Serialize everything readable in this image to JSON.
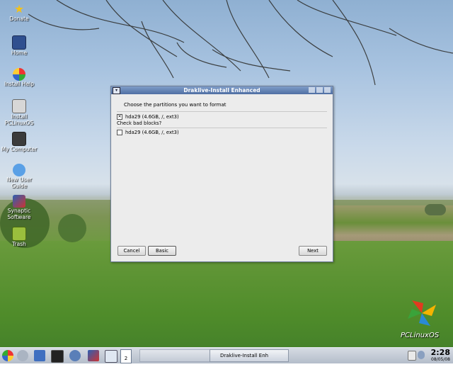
{
  "desktop": {
    "icons": [
      {
        "label": "Donate",
        "icon": "star-icon"
      },
      {
        "label": "Home",
        "icon": "home-folder-icon"
      },
      {
        "label": "Install Help",
        "icon": "help-icon"
      },
      {
        "label": "Install PCLinuxOS",
        "icon": "install-icon"
      },
      {
        "label": "My Computer",
        "icon": "computer-icon"
      },
      {
        "label": "New User Guide",
        "icon": "user-guide-icon"
      },
      {
        "label": "Synaptic Software",
        "icon": "synaptic-icon"
      },
      {
        "label": "Trash",
        "icon": "trash-icon"
      }
    ],
    "brand_text": "PCLinuxOS"
  },
  "dialog": {
    "title": "Draklive-Install Enhanced",
    "prompt": "Choose the partitions you want to format",
    "format_partitions": [
      {
        "label": "hda29 (4.6GB, /, ext3)",
        "checked": true
      }
    ],
    "bad_blocks_heading": "Check bad blocks?",
    "badblock_partitions": [
      {
        "label": "hda29 (4.6GB, /, ext3)",
        "checked": false
      }
    ],
    "buttons": {
      "cancel": "Cancel",
      "basic": "Basic",
      "next": "Next"
    }
  },
  "taskbar": {
    "pager_value": "2",
    "task_label": "Draklive-Install Enh",
    "clock_time": "2:28",
    "clock_date": "08/05/08"
  },
  "colors": {
    "titlebar": "#4f6fa3",
    "dialog_bg": "#ececec",
    "taskbar": "#c4cbd6"
  }
}
